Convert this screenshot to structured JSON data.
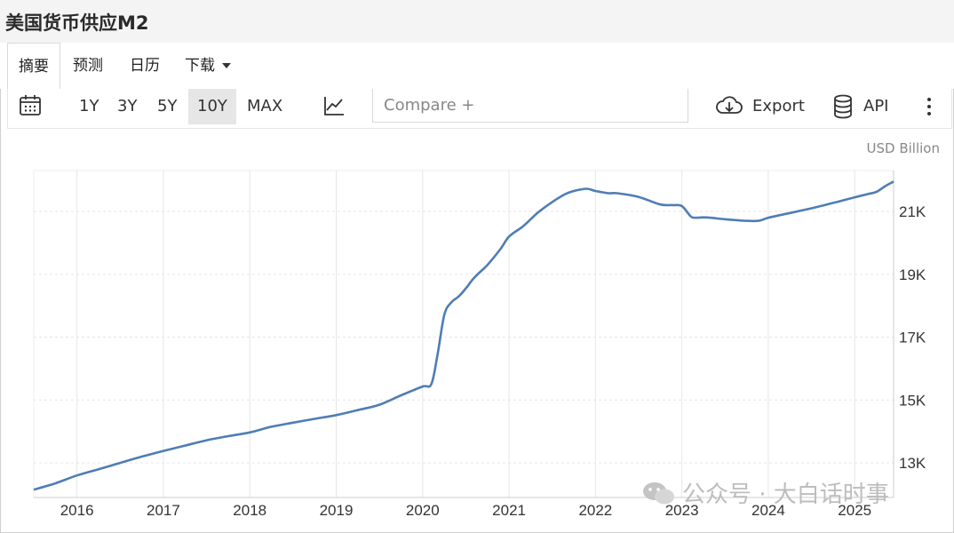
{
  "header": {
    "title": "美国货币供应M2"
  },
  "tabs": [
    {
      "label": "摘要",
      "active": true
    },
    {
      "label": "预测"
    },
    {
      "label": "日历"
    },
    {
      "label": "下载"
    }
  ],
  "toolbar": {
    "ranges": [
      "1Y",
      "3Y",
      "5Y",
      "10Y",
      "MAX"
    ],
    "selected_range": "10Y",
    "compare_placeholder": "Compare +",
    "export_label": "Export",
    "api_label": "API"
  },
  "unit_label": "USD Billion",
  "watermark": "公众号 · 大白话时事",
  "colors": {
    "line": "#4f7db5",
    "grid": "#e6e6e6",
    "axis_text": "#333333"
  },
  "chart_data": {
    "type": "line",
    "xlabel": "",
    "ylabel": "",
    "x_ticks": [
      "2016",
      "2017",
      "2018",
      "2019",
      "2020",
      "2021",
      "2022",
      "2023",
      "2024",
      "2025"
    ],
    "y_ticks": [
      "13K",
      "15K",
      "17K",
      "19K",
      "21K"
    ],
    "ylim": [
      11900,
      22300
    ],
    "xlim": [
      2015.5,
      2025.45
    ],
    "grid": true,
    "series": [
      {
        "x": [
          2015.5,
          2015.75,
          2016.0,
          2016.25,
          2016.5,
          2016.75,
          2017.0,
          2017.25,
          2017.5,
          2017.75,
          2018.0,
          2018.25,
          2018.5,
          2018.75,
          2019.0,
          2019.25,
          2019.5,
          2019.75,
          2020.0,
          2020.1,
          2020.17,
          2020.25,
          2020.33,
          2020.42,
          2020.5,
          2020.6,
          2020.75,
          2020.9,
          2021.0,
          2021.15,
          2021.25,
          2021.35,
          2021.5,
          2021.65,
          2021.75,
          2021.9,
          2022.0,
          2022.15,
          2022.25,
          2022.5,
          2022.75,
          2022.9,
          2023.0,
          2023.1,
          2023.15,
          2023.25,
          2023.33,
          2023.5,
          2023.75,
          2023.9,
          2024.0,
          2024.25,
          2024.5,
          2024.75,
          2025.0,
          2025.15,
          2025.25,
          2025.35,
          2025.45
        ],
        "values": [
          12150,
          12350,
          12600,
          12800,
          13000,
          13200,
          13380,
          13550,
          13720,
          13850,
          13970,
          14150,
          14280,
          14400,
          14520,
          14680,
          14850,
          15150,
          15430,
          15500,
          16400,
          17700,
          18100,
          18300,
          18550,
          18900,
          19300,
          19800,
          20200,
          20500,
          20750,
          21000,
          21300,
          21550,
          21650,
          21720,
          21650,
          21580,
          21580,
          21460,
          21220,
          21200,
          21170,
          20850,
          20800,
          20810,
          20800,
          20750,
          20700,
          20710,
          20800,
          20950,
          21100,
          21270,
          21450,
          21550,
          21620,
          21800,
          21950
        ]
      }
    ]
  }
}
